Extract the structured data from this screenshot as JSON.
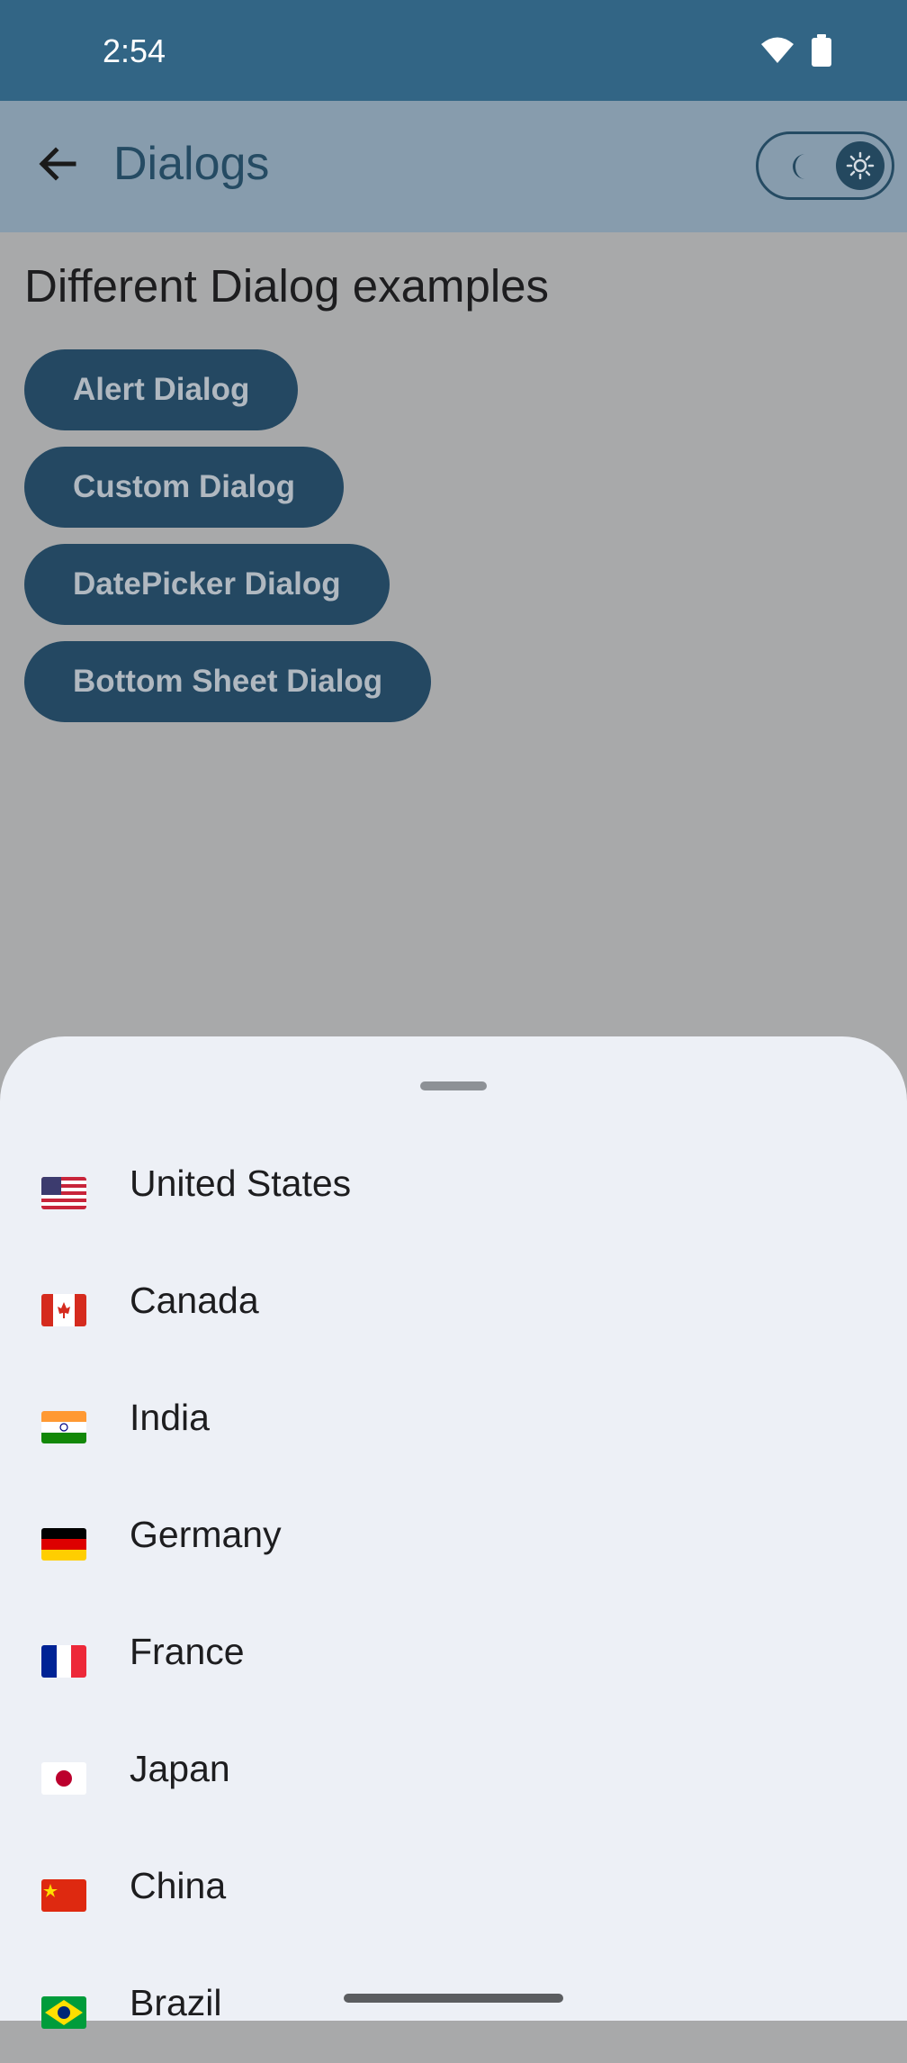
{
  "status_bar": {
    "time": "2:54",
    "wifi_icon": "wifi-icon",
    "battery_icon": "battery-icon"
  },
  "app_bar": {
    "back_icon": "back-arrow-icon",
    "title": "Dialogs",
    "theme_toggle": {
      "moon_icon": "moon-icon",
      "sun_icon": "sun-icon",
      "selected": "light"
    }
  },
  "content": {
    "heading": "Different Dialog examples",
    "buttons": [
      {
        "label": "Alert Dialog"
      },
      {
        "label": "Custom Dialog"
      },
      {
        "label": "DatePicker Dialog"
      },
      {
        "label": "Bottom Sheet Dialog"
      }
    ]
  },
  "bottom_sheet": {
    "countries": [
      {
        "name": "United States",
        "flag": "us-flag-icon"
      },
      {
        "name": "Canada",
        "flag": "canada-flag-icon"
      },
      {
        "name": "India",
        "flag": "india-flag-icon"
      },
      {
        "name": "Germany",
        "flag": "germany-flag-icon"
      },
      {
        "name": "France",
        "flag": "france-flag-icon"
      },
      {
        "name": "Japan",
        "flag": "japan-flag-icon"
      },
      {
        "name": "China",
        "flag": "china-flag-icon"
      },
      {
        "name": "Brazil",
        "flag": "brazil-flag-icon"
      }
    ]
  },
  "colors": {
    "status_bar": "#326585",
    "app_bar": "#879cad",
    "scrim_background": "#a8a9aa",
    "button": "#244862",
    "sheet": "#edf0f6"
  }
}
